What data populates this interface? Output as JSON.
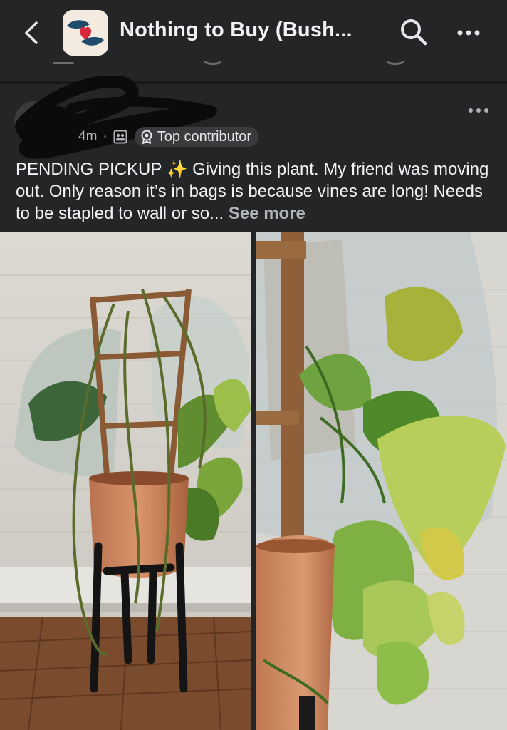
{
  "header": {
    "group_name": "Nothing to Buy (Bush...",
    "back_icon": "chevron-left-icon",
    "search_icon": "search-icon",
    "more_icon": "more-horizontal-icon"
  },
  "post": {
    "time_fragment": "4m",
    "separator": "·",
    "audience_icon": "group-members-icon",
    "badge_label": "Top contributor",
    "badge_icon": "award-icon",
    "text_before_emoji": "PENDING PICKUP ",
    "sparkle": "✨",
    "text_after_emoji": " Giving this plant. My friend was moving out. Only reason it’s in bags is because vines are long! Needs to be stapled to wall or so...",
    "see_more": "See more",
    "more_icon": "more-horizontal-icon"
  },
  "photos": [
    {
      "subject": "plant-in-terracotta-pot-on-black-stand"
    },
    {
      "subject": "close-up-of-monstera-leaves-and-bag"
    }
  ],
  "colors": {
    "background": "#242526",
    "text": "#f0f2f5",
    "muted": "#b0b3b8",
    "badge_bg": "#3a3b3c"
  }
}
